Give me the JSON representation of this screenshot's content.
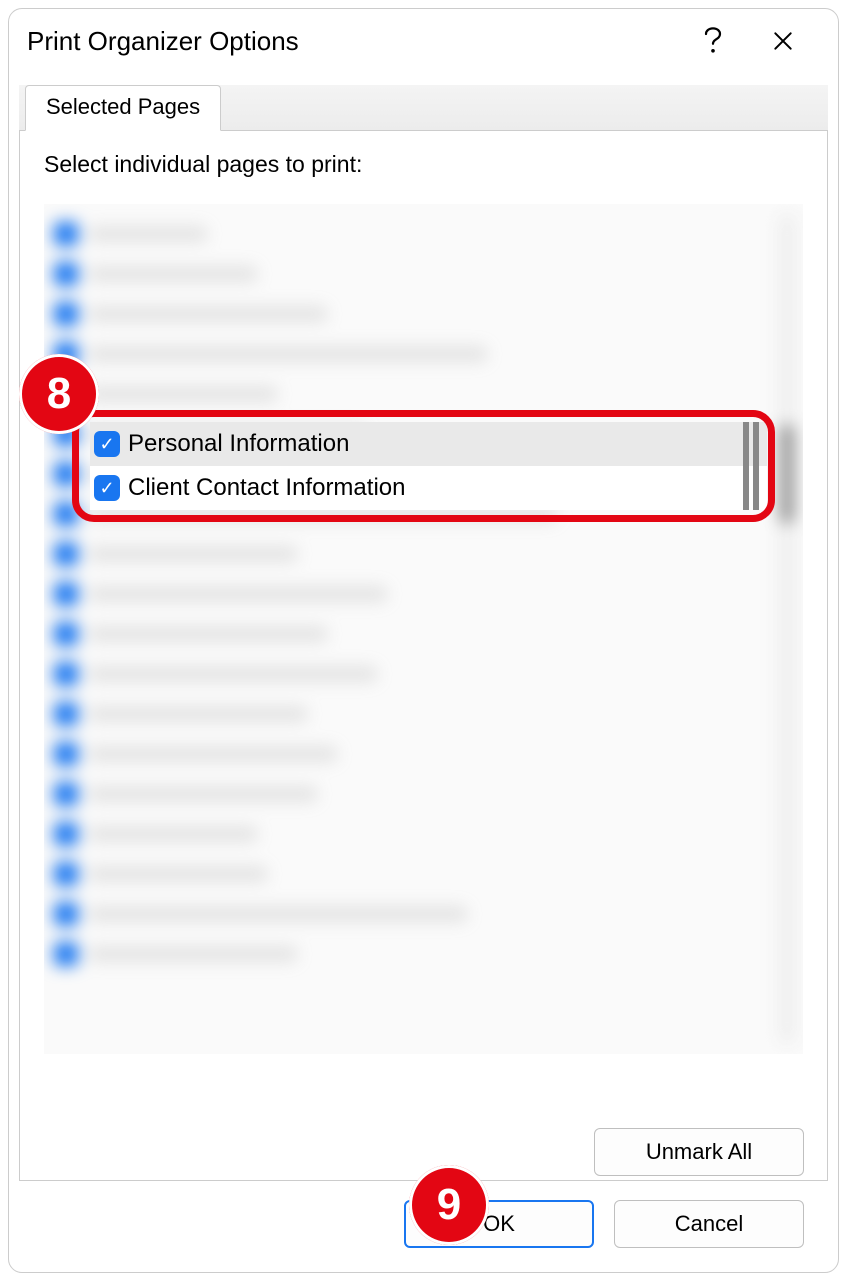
{
  "dialog": {
    "title": "Print Organizer Options",
    "tab_label": "Selected Pages",
    "instruction": "Select individual pages to print:"
  },
  "pages": {
    "visible": [
      {
        "label": "Personal Information",
        "checked": true
      },
      {
        "label": "Client Contact Information",
        "checked": true
      }
    ]
  },
  "buttons": {
    "unmark_all": "Unmark All",
    "ok": "OK",
    "cancel": "Cancel"
  },
  "callouts": {
    "step8": "8",
    "step9": "9"
  },
  "colors": {
    "accent": "#1976f0",
    "callout": "#e30613"
  }
}
